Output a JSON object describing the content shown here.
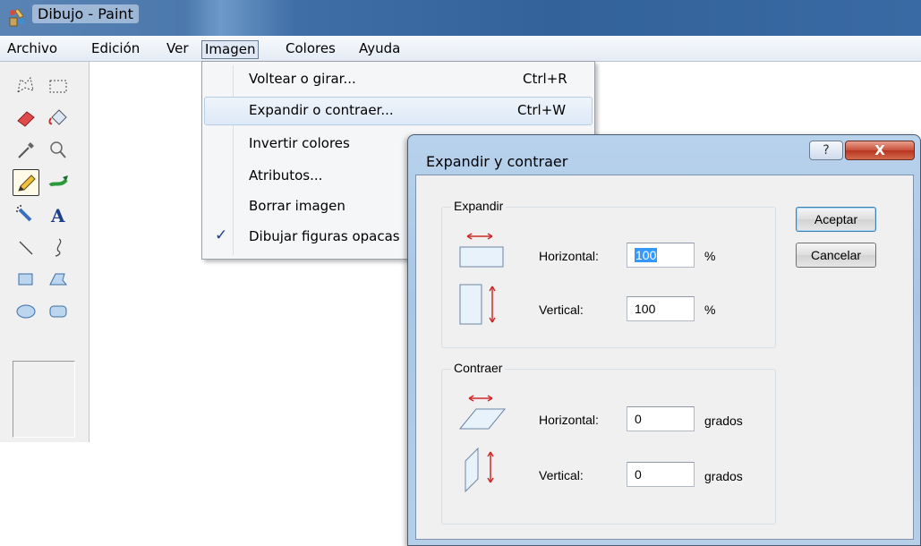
{
  "window": {
    "title": "Dibujo - Paint"
  },
  "menubar": {
    "items": [
      {
        "label": "Archivo"
      },
      {
        "label": "Edición"
      },
      {
        "label": "Ver"
      },
      {
        "label": "Imagen",
        "open": true
      },
      {
        "label": "Colores"
      },
      {
        "label": "Ayuda"
      }
    ]
  },
  "toolbox": {
    "tools": [
      {
        "icon": "free-select-icon"
      },
      {
        "icon": "rect-select-icon"
      },
      {
        "icon": "eraser-icon"
      },
      {
        "icon": "fill-bucket-icon"
      },
      {
        "icon": "color-picker-icon"
      },
      {
        "icon": "magnifier-icon"
      },
      {
        "icon": "pencil-icon",
        "active": true
      },
      {
        "icon": "brush-icon"
      },
      {
        "icon": "airbrush-icon"
      },
      {
        "icon": "text-icon",
        "glyph": "A"
      },
      {
        "icon": "line-icon"
      },
      {
        "icon": "curve-icon"
      },
      {
        "icon": "rectangle-icon"
      },
      {
        "icon": "polygon-icon"
      },
      {
        "icon": "ellipse-icon"
      },
      {
        "icon": "rounded-rect-icon"
      }
    ]
  },
  "image_menu": {
    "items": [
      {
        "label": "Voltear o girar...",
        "shortcut": "Ctrl+R"
      },
      {
        "label": "Expandir o contraer...",
        "shortcut": "Ctrl+W",
        "highlighted": true
      },
      {
        "label": "Invertir colores",
        "shortcut": ""
      },
      {
        "label": "Atributos...",
        "shortcut": ""
      },
      {
        "label": "Borrar imagen",
        "shortcut": ""
      },
      {
        "label": "Dibujar figuras opacas",
        "shortcut": "",
        "checked": true,
        "check_glyph": "✓"
      }
    ]
  },
  "dialog": {
    "title": "Expandir y contraer",
    "help_glyph": "?",
    "close_glyph": "X",
    "expand": {
      "title": "Expandir",
      "horizontal_label": "Horizontal:",
      "horizontal_value": "100",
      "horizontal_unit": "%",
      "vertical_label": "Vertical:",
      "vertical_value": "100",
      "vertical_unit": "%"
    },
    "contract": {
      "title": "Contraer",
      "horizontal_label": "Horizontal:",
      "horizontal_value": "0",
      "horizontal_unit": "grados",
      "vertical_label": "Vertical:",
      "vertical_value": "0",
      "vertical_unit": "grados"
    },
    "ok_label": "Aceptar",
    "cancel_label": "Cancelar"
  },
  "colors": {
    "accent_selection": "#3399ff",
    "arrow_red": "#d02a2a",
    "close_red": "#c8503a"
  }
}
